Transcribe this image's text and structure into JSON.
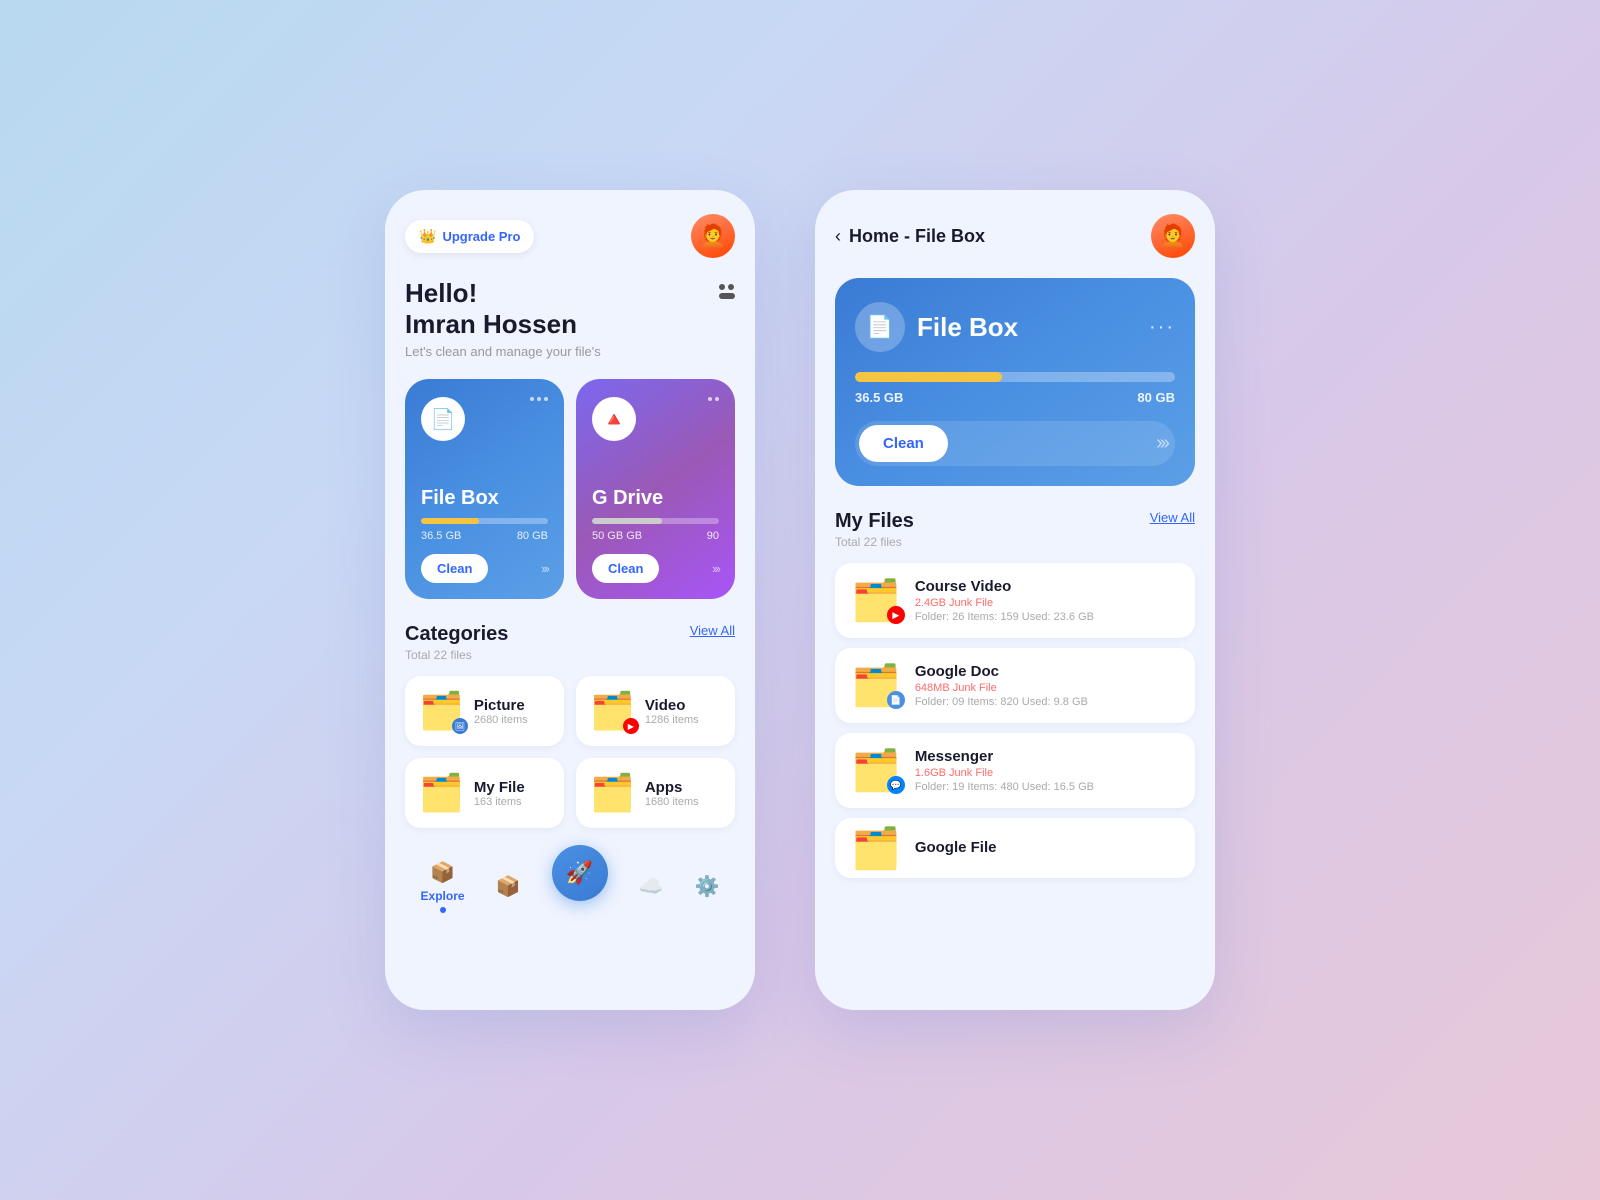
{
  "left_phone": {
    "upgrade_btn": "Upgrade Pro",
    "greeting_hello": "Hello!",
    "greeting_name": "Imran Hossen",
    "greeting_sub": "Let's clean and manage your file's",
    "cards": [
      {
        "id": "filebox",
        "title": "File Box",
        "used": "36.5 GB",
        "total": "80 GB",
        "fill_pct": 46,
        "clean_label": "Clean",
        "color": "blue"
      },
      {
        "id": "gdrive",
        "title": "G Drive",
        "used": "50 GB GB",
        "total": "90",
        "fill_pct": 55,
        "clean_label": "Clean",
        "color": "purple"
      }
    ],
    "categories_title": "Categories",
    "categories_sub": "Total 22 files",
    "view_all": "View All",
    "categories": [
      {
        "id": "picture",
        "name": "Picture",
        "count": "2680 items",
        "icon": "🗂️"
      },
      {
        "id": "video",
        "name": "Video",
        "count": "1286 items",
        "icon": "🗂️"
      },
      {
        "id": "myfile",
        "name": "My File",
        "count": "163 items",
        "icon": "🗂️"
      },
      {
        "id": "apps",
        "name": "Apps",
        "count": "1680 items",
        "icon": "🗂️"
      }
    ],
    "nav": [
      {
        "id": "explore",
        "label": "Explore",
        "active": true
      },
      {
        "id": "box",
        "label": "",
        "active": false
      },
      {
        "id": "rocket",
        "label": "",
        "active": false
      },
      {
        "id": "cloud",
        "label": "",
        "active": false
      },
      {
        "id": "settings",
        "label": "",
        "active": false
      }
    ]
  },
  "right_phone": {
    "back_label": "‹",
    "page_title": "Home - File Box",
    "filebox_card": {
      "title": "File Box",
      "used": "36.5 GB",
      "total": "80 GB",
      "fill_pct": 46,
      "clean_label": "Clean"
    },
    "my_files_title": "My Files",
    "my_files_sub": "Total 22 files",
    "view_all": "View All",
    "files": [
      {
        "id": "course_video",
        "name": "Course Video",
        "junk": "2.4GB Junk File",
        "meta": "Folder: 26 Items: 159 Used: 23.6 GB",
        "badge_color": "yt"
      },
      {
        "id": "google_doc",
        "name": "Google Doc",
        "junk": "648MB Junk File",
        "meta": "Folder: 09  Items: 820  Used: 9.8 GB",
        "badge_color": "doc"
      },
      {
        "id": "messenger",
        "name": "Messenger",
        "junk": "1.6GB Junk File",
        "meta": "Folder: 19  Items: 480  Used: 16.5 GB",
        "badge_color": "msg"
      },
      {
        "id": "google_file",
        "name": "Google File",
        "junk": "",
        "meta": "",
        "badge_color": "gf"
      }
    ]
  }
}
